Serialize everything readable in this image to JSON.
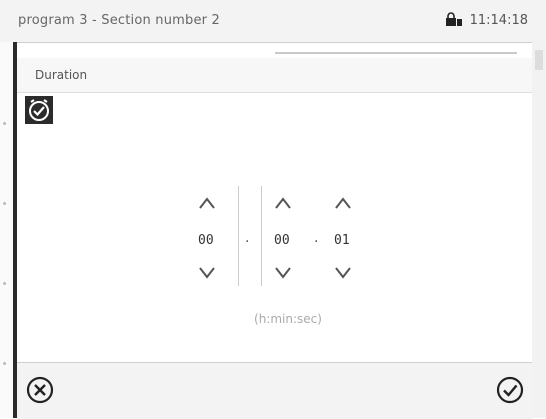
{
  "header": {
    "title": "program 3 - Section number 2",
    "clock": "11:14:18",
    "lock_icon": "lock-icon"
  },
  "section": {
    "label": "Duration"
  },
  "duration": {
    "hours": "00",
    "minutes": "00",
    "seconds": "01",
    "separator_1": ".",
    "separator_2": ".",
    "unit": "(h:min:sec)"
  },
  "footer": {
    "cancel_icon": "close-circle-icon",
    "confirm_icon": "check-circle-icon"
  },
  "colors": {
    "accent": "#2b2b2b",
    "background": "#ffffff"
  }
}
